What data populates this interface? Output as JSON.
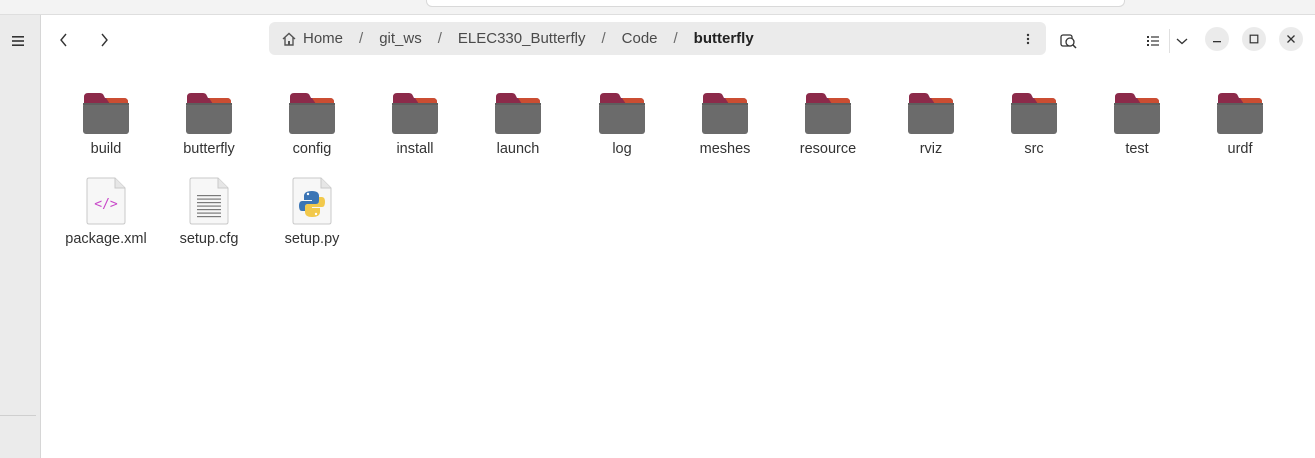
{
  "window": {
    "title": "butterfly"
  },
  "toolbar": {
    "menu_icon": "hamburger-menu-icon",
    "back_icon": "chevron-left-icon",
    "forward_icon": "chevron-right-icon",
    "search_icon": "search-icon",
    "view_icon": "list-view-icon",
    "view_dropdown_icon": "chevron-down-icon"
  },
  "pathbar": {
    "crumbs": [
      {
        "label": "Home",
        "icon": "home-icon"
      },
      {
        "label": "git_ws"
      },
      {
        "label": "ELEC330_Butterfly"
      },
      {
        "label": "Code"
      },
      {
        "label": "butterfly"
      }
    ],
    "separator": "/",
    "menu_icon": "vertical-dots-icon"
  },
  "files": [
    {
      "name": "build",
      "type": "folder"
    },
    {
      "name": "butterfly",
      "type": "folder"
    },
    {
      "name": "config",
      "type": "folder"
    },
    {
      "name": "install",
      "type": "folder"
    },
    {
      "name": "launch",
      "type": "folder"
    },
    {
      "name": "log",
      "type": "folder"
    },
    {
      "name": "meshes",
      "type": "folder"
    },
    {
      "name": "resource",
      "type": "folder"
    },
    {
      "name": "rviz",
      "type": "folder"
    },
    {
      "name": "src",
      "type": "folder"
    },
    {
      "name": "test",
      "type": "folder"
    },
    {
      "name": "urdf",
      "type": "folder"
    },
    {
      "name": "package.xml",
      "type": "xml"
    },
    {
      "name": "setup.cfg",
      "type": "text"
    },
    {
      "name": "setup.py",
      "type": "python"
    }
  ],
  "colors": {
    "folder_tab": "#8c2a4a",
    "folder_tab_accent": "#e05a2b",
    "folder_body": "#6b6b6b",
    "pathbar_bg": "#ebebeb",
    "sidebar_bg": "#ebebeb"
  }
}
